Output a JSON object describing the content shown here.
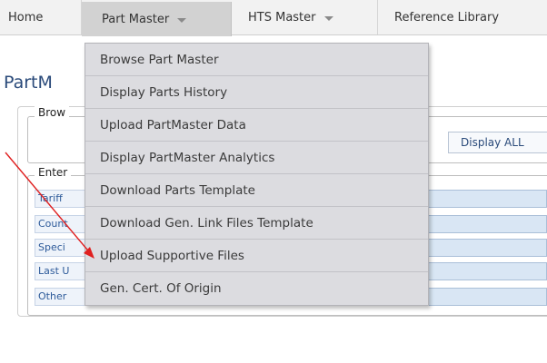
{
  "nav": {
    "tabs": [
      {
        "label": "Home"
      },
      {
        "label": "Part Master",
        "icon": "chevron-down-icon"
      },
      {
        "label": "HTS Master",
        "icon": "chevron-down-icon"
      },
      {
        "label": "Reference Library"
      }
    ]
  },
  "page": {
    "title": "PartM",
    "browse_legend": "Brow",
    "display_all_button": "Display ALL",
    "enter_legend": "Enter",
    "rows": [
      {
        "label": "Tariff",
        "field": ""
      },
      {
        "label": "Count",
        "field": ""
      },
      {
        "label": "Speci",
        "field": ""
      },
      {
        "label": "Last U",
        "field": ""
      },
      {
        "label": "Other",
        "field": ">>"
      }
    ]
  },
  "dropdown": {
    "items": [
      {
        "label": "Browse Part Master"
      },
      {
        "label": "Display Parts History"
      },
      {
        "label": "Upload PartMaster Data"
      },
      {
        "label": "Display PartMaster Analytics"
      },
      {
        "label": "Download Parts Template"
      },
      {
        "label": "Download Gen. Link Files Template"
      },
      {
        "label": "Upload Supportive Files"
      },
      {
        "label": "Gen. Cert. Of Origin"
      }
    ]
  },
  "colors": {
    "annotation_arrow": "#e02020",
    "dropdown_bg": "#dcdce0",
    "active_tab_bg": "#d2d2d2",
    "title": "#2a4a7a"
  }
}
